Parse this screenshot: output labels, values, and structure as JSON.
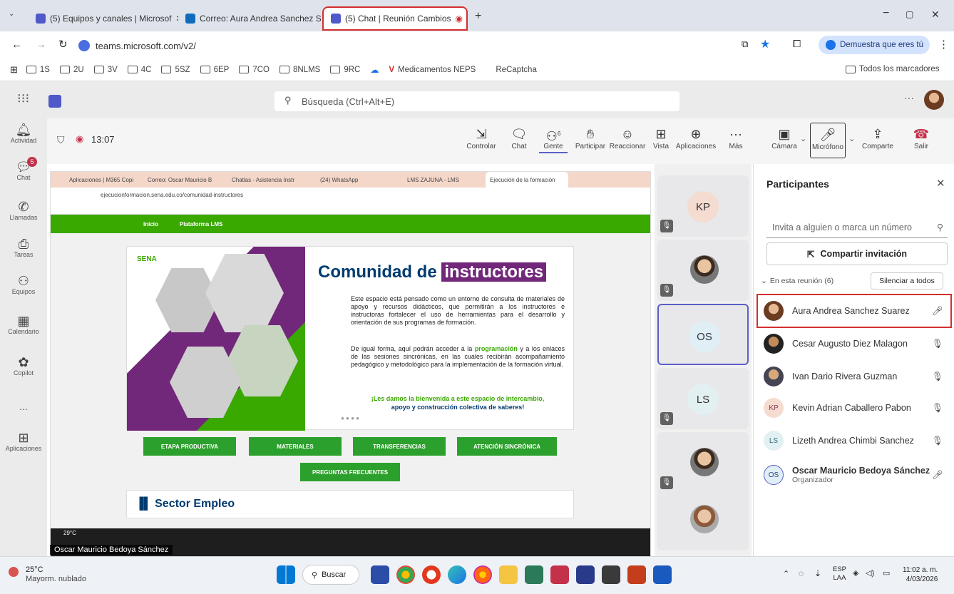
{
  "browser": {
    "tabs": [
      {
        "label": "(5) Equipos y canales | Microsof"
      },
      {
        "label": "Correo: Aura Andrea Sanchez S"
      },
      {
        "label": "(5) Chat | Reunión Cambios"
      }
    ],
    "url": "teams.microsoft.com/v2/",
    "profile_label": "Demuestra que eres tú",
    "bookmarks": [
      "1S",
      "2U",
      "3V",
      "4C",
      "5SZ",
      "6EP",
      "7CO",
      "8NLMS",
      "9RC",
      "Medicamentos NEPS",
      "ReCaptcha"
    ],
    "all_bookmarks": "Todos los marcadores"
  },
  "teams": {
    "search_placeholder": "Búsqueda (Ctrl+Alt+E)",
    "rail": [
      {
        "label": "Actividad",
        "icon": "bell-icon"
      },
      {
        "label": "Chat",
        "icon": "chat-icon",
        "badge": "5"
      },
      {
        "label": "Llamadas",
        "icon": "phone-icon"
      },
      {
        "label": "Tareas",
        "icon": "tasks-icon"
      },
      {
        "label": "Equipos",
        "icon": "teams-icon"
      },
      {
        "label": "Calendario",
        "icon": "calendar-icon"
      },
      {
        "label": "Copilot",
        "icon": "copilot-icon"
      },
      {
        "label": "...",
        "icon": "more-icon"
      },
      {
        "label": "Aplicaciones",
        "icon": "apps-icon"
      }
    ],
    "meeting_time": "13:07",
    "toolbar": {
      "controlar": "Controlar",
      "chat": "Chat",
      "gente": "Gente",
      "gente_count": "6",
      "participar": "Participar",
      "reaccionar": "Reaccionar",
      "vista": "Vista",
      "aplicaciones": "Aplicaciones",
      "mas": "Más",
      "camara": "Cámara",
      "microfono": "Micrófono",
      "compartir": "Comparte",
      "salir": "Salir"
    },
    "video_tiles": [
      {
        "initials": "KP"
      },
      {
        "initials": ""
      },
      {
        "initials": "OS"
      },
      {
        "initials": "LS"
      },
      {
        "initials": ""
      },
      {
        "initials": ""
      }
    ],
    "presenter_name": "Oscar Mauricio Bedoya Sánchez",
    "weather_small": "29°C"
  },
  "participants": {
    "title": "Participantes",
    "invite_placeholder": "Invita a alguien o marca un número",
    "share_invite": "Compartir invitación",
    "in_meeting": "En esta reunión (6)",
    "mute_all": "Silenciar a todos",
    "list": [
      {
        "name": "Aura Andrea Sanchez Suarez",
        "initials": "",
        "mic": "on"
      },
      {
        "name": "Cesar Augusto Diez Malagon",
        "initials": "",
        "mic": "off"
      },
      {
        "name": "Ivan Dario Rivera Guzman",
        "initials": "",
        "mic": "off"
      },
      {
        "name": "Kevin Adrian Caballero Pabon",
        "initials": "KP",
        "mic": "off"
      },
      {
        "name": "Lizeth Andrea Chimbi Sanchez",
        "initials": "LS",
        "mic": "off"
      },
      {
        "name": "Oscar Mauricio Bedoya Sánchez",
        "initials": "OS",
        "role": "Organizador",
        "mic": "on"
      }
    ]
  },
  "shared": {
    "tabs": [
      "Aplicaciones | M365 Copi",
      "Correo: Oscar Mauricio B",
      "Chatlas - Asistencia Instr",
      "(24) WhatsApp",
      "LMS ZAJUNA - LMS",
      "Ejecución de la formación"
    ],
    "url": "ejecucionformacion.sena.edu.co/comunidad-instructores",
    "nav": [
      "Inicio",
      "Plataforma LMS"
    ],
    "heading_a": "Comunidad de",
    "heading_b": "instructores",
    "para1": "Este espacio está pensado como un entorno de consulta de materiales de apoyo y recursos didácticos, que permitirán a los instructores e instructoras fortalecer el uso de herramientas para el desarrollo y orientación de sus programas de formación.",
    "para2a": "De igual forma, aquí podrán acceder a la",
    "para2_link": "programación",
    "para2b": "y a los enlaces de las sesiones sincrónicas, en las cuales recibirán acompañamiento pedagógico y metodológico para la implementación de la formación virtual.",
    "welcome1": "¡Les damos la bienvenida a este espacio de intercambio,",
    "welcome2": "apoyo y construcción colectiva de saberes!",
    "buttons": [
      "ETAPA PRODUCTIVA",
      "MATERIALES",
      "TRANSFERENCIAS",
      "ATENCIÓN SINCRÓNICA",
      "PREGUNTAS FRECUENTES"
    ],
    "sector": "Sector Empleo",
    "logo": "SENA"
  },
  "taskbar": {
    "weather_temp": "25°C",
    "weather_desc": "Mayorm. nublado",
    "search": "Buscar",
    "lang1": "ESP",
    "lang2": "LAA",
    "time": "11:02 a. m.",
    "date": "4/03/2026"
  },
  "colors": {
    "accent": "#5b5fc7",
    "sena_green": "#39a900",
    "purple": "#71277a",
    "highlight_red": "#d32f2f"
  }
}
